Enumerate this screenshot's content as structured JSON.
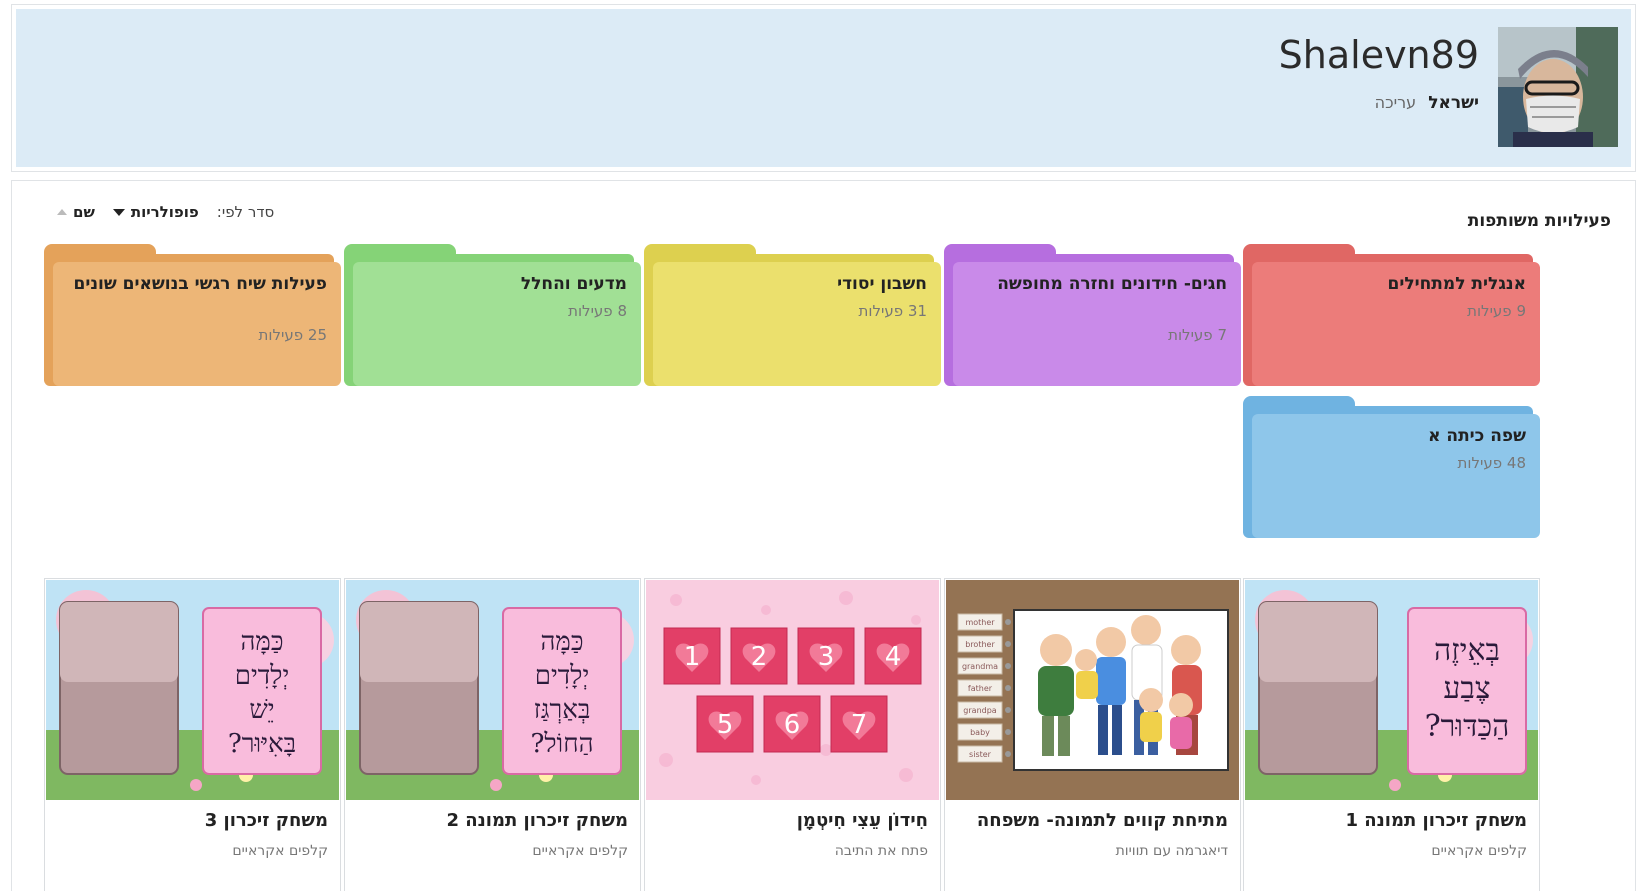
{
  "profile": {
    "username": "Shalevn89",
    "country": "ישראל",
    "edit_label": "עריכה"
  },
  "content": {
    "section_title": "פעילויות משותפות",
    "sort": {
      "label": "סדר לפי:",
      "popularity": "פופולריות",
      "name": "שם"
    }
  },
  "folders": [
    {
      "title": "אנגלית למתחילים",
      "count": "9 פעילות",
      "color": "#ec7c7a",
      "color_dark": "#e06764"
    },
    {
      "title": "חגים- חידונים וחזרה מחופשה",
      "count": "7 פעילות",
      "color": "#c98ae9",
      "color_dark": "#b66edf"
    },
    {
      "title": "חשבון יסודי",
      "count": "31 פעילות",
      "color": "#ebe06d",
      "color_dark": "#ddd04f"
    },
    {
      "title": "מדעים והחלל",
      "count": "8 פעילות",
      "color": "#a1e095",
      "color_dark": "#85d377"
    },
    {
      "title": "פעילות שיח רגשי בנושאים שונים",
      "count": "25 פעילות",
      "color": "#edb677",
      "color_dark": "#e4a25a"
    },
    {
      "title": "שפה כיתה א",
      "count": "48 פעילות",
      "color": "#8ec6ea",
      "color_dark": "#6fb3e1"
    }
  ],
  "activities": [
    {
      "title": "משחק זיכרון תמונה 1",
      "type": "קלפים אקראיים",
      "card_lines": [
        "בְּאֵיזֶה",
        "צֶבַע",
        "הַכַּדּוּר?"
      ]
    },
    {
      "title": "מתיחת קווים לתמונה- משפחה",
      "type": "דיאגרמה עם תוויות",
      "labels": [
        "mother",
        "brother",
        "grandma",
        "father",
        "grandpa",
        "baby",
        "sister"
      ]
    },
    {
      "title": "חִידוֹן עֵצִי חִיטְמָן",
      "type": "פתח את התיבה",
      "numbers": [
        "1",
        "2",
        "3",
        "4",
        "5",
        "6",
        "7"
      ]
    },
    {
      "title": "משחק זיכרון תמונה 2",
      "type": "קלפים אקראיים",
      "card_lines": [
        "כַּמָּה",
        "יְלָדִים",
        "בְּאַרְגַּז",
        "הַחוֹל?"
      ]
    },
    {
      "title": "משחק זיכרון 3",
      "type": "קלפים אקראיים",
      "card_lines": [
        "כַּמָּה",
        "יְלָדִים",
        "יֵשׁ",
        "בָּאִיּוּר?"
      ]
    }
  ]
}
